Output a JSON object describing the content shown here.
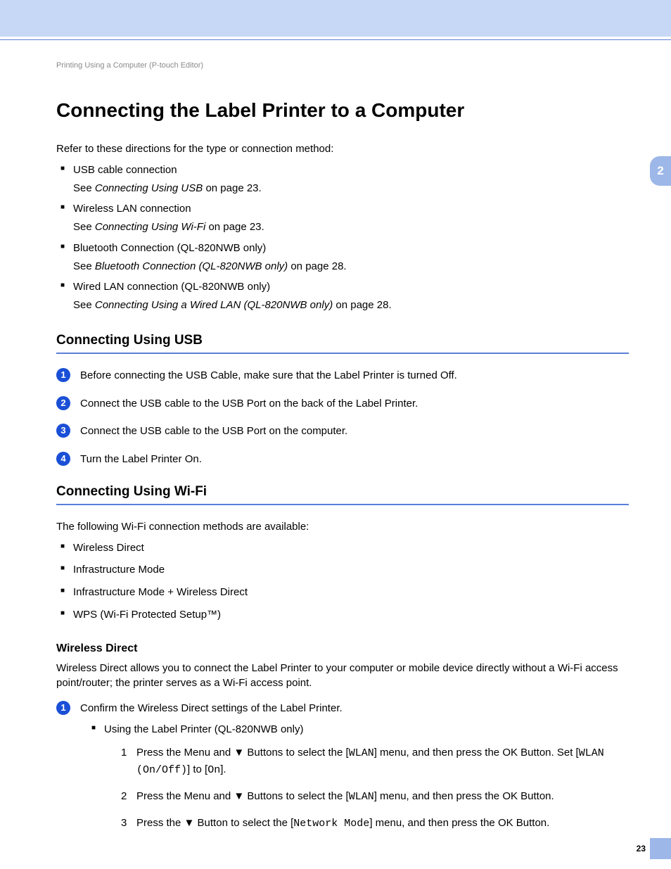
{
  "runningHead": "Printing Using a Computer (P-touch Editor)",
  "title": "Connecting the Label Printer to a Computer",
  "intro": "Refer to these directions for the type or connection method:",
  "connList": [
    {
      "label": "USB cable connection",
      "see_pre": "See ",
      "see_ref": "Connecting Using USB",
      "see_post": " on page 23."
    },
    {
      "label": "Wireless LAN connection",
      "see_pre": "See ",
      "see_ref": "Connecting Using Wi-Fi",
      "see_post": " on page 23."
    },
    {
      "label": "Bluetooth Connection (QL-820NWB only)",
      "see_pre": "See ",
      "see_ref": "Bluetooth Connection (QL-820NWB only)",
      "see_post": " on page 28."
    },
    {
      "label": "Wired LAN connection (QL-820NWB only)",
      "see_pre": "See ",
      "see_ref": "Connecting Using a Wired LAN (QL-820NWB only)",
      "see_post": " on page 28."
    }
  ],
  "usb": {
    "heading": "Connecting Using USB",
    "steps": [
      "Before connecting the USB Cable, make sure that the Label Printer is turned Off.",
      "Connect the USB cable to the USB Port on the back of the Label Printer.",
      "Connect the USB cable to the USB Port on the computer.",
      "Turn the Label Printer On."
    ]
  },
  "wifi": {
    "heading": "Connecting Using Wi-Fi",
    "intro": "The following Wi-Fi connection methods are available:",
    "methods": [
      "Wireless Direct",
      "Infrastructure Mode",
      "Infrastructure Mode + Wireless Direct",
      "WPS (Wi-Fi Protected Setup™)"
    ],
    "wd": {
      "heading": "Wireless Direct",
      "desc": "Wireless Direct allows you to connect the Label Printer to your computer or mobile device directly without a Wi-Fi access point/router; the printer serves as a Wi-Fi access point.",
      "step1": "Confirm the Wireless Direct settings of the Label Printer.",
      "usingLabel": "Using the Label Printer (QL-820NWB only)",
      "sub": {
        "s1a": "Press the Menu and ▼ Buttons to select the [",
        "s1code1": "WLAN",
        "s1b": "] menu, and then press the OK Button. Set [",
        "s1code2": "WLAN (On/Off)",
        "s1c": "] to [",
        "s1code3": "On",
        "s1d": "].",
        "s2a": "Press the Menu and ▼ Buttons to select the [",
        "s2code1": "WLAN",
        "s2b": "] menu, and then press the OK Button.",
        "s3a": "Press the ▼ Button to select the [",
        "s3code1": "Network Mode",
        "s3b": "] menu, and then press the OK Button."
      }
    }
  },
  "chapterTab": "2",
  "pageNumber": "23"
}
